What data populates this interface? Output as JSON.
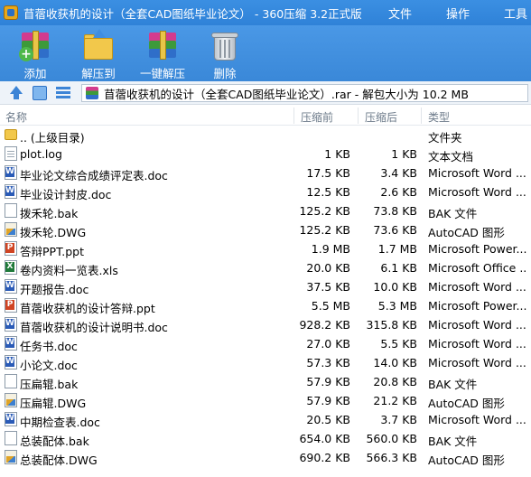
{
  "window": {
    "title": "苜蓿收获机的设计（全套CAD图纸毕业论文） - 360压缩 3.2正式版",
    "menus": [
      "文件",
      "操作",
      "工具"
    ]
  },
  "toolbar": {
    "buttons": [
      {
        "label": "添加",
        "icon": "add-archive-icon"
      },
      {
        "label": "解压到",
        "icon": "extract-to-folder-icon"
      },
      {
        "label": "一键解压",
        "icon": "one-click-extract-icon"
      },
      {
        "label": "删除",
        "icon": "trash-icon"
      }
    ]
  },
  "address": {
    "path": "苜蓿收获机的设计（全套CAD图纸毕业论文）.rar - 解包大小为 10.2 MB"
  },
  "columns": {
    "name": "名称",
    "size": "压缩前",
    "packed": "压缩后",
    "type": "类型"
  },
  "files": [
    {
      "name": ".. (上级目录)",
      "size": "",
      "packed": "",
      "type": "文件夹",
      "icon": "folder"
    },
    {
      "name": "plot.log",
      "size": "1 KB",
      "packed": "1 KB",
      "type": "文本文档",
      "icon": "txt"
    },
    {
      "name": "毕业论文综合成绩评定表.doc",
      "size": "17.5 KB",
      "packed": "3.4 KB",
      "type": "Microsoft Word ...",
      "icon": "doc"
    },
    {
      "name": "毕业设计封皮.doc",
      "size": "12.5 KB",
      "packed": "2.6 KB",
      "type": "Microsoft Word ...",
      "icon": "doc"
    },
    {
      "name": "拨禾轮.bak",
      "size": "125.2 KB",
      "packed": "73.8 KB",
      "type": "BAK 文件",
      "icon": "bak"
    },
    {
      "name": "拨禾轮.DWG",
      "size": "125.2 KB",
      "packed": "73.6 KB",
      "type": "AutoCAD 图形",
      "icon": "dwg"
    },
    {
      "name": "答辩PPT.ppt",
      "size": "1.9 MB",
      "packed": "1.7 MB",
      "type": "Microsoft Power...",
      "icon": "ppt"
    },
    {
      "name": "卷内资料一览表.xls",
      "size": "20.0 KB",
      "packed": "6.1 KB",
      "type": "Microsoft Office ...",
      "icon": "xls"
    },
    {
      "name": "开题报告.doc",
      "size": "37.5 KB",
      "packed": "10.0 KB",
      "type": "Microsoft Word ...",
      "icon": "doc"
    },
    {
      "name": "苜蓿收获机的设计答辩.ppt",
      "size": "5.5 MB",
      "packed": "5.3 MB",
      "type": "Microsoft Power...",
      "icon": "ppt"
    },
    {
      "name": "苜蓿收获机的设计说明书.doc",
      "size": "928.2 KB",
      "packed": "315.8 KB",
      "type": "Microsoft Word ...",
      "icon": "doc"
    },
    {
      "name": "任务书.doc",
      "size": "27.0 KB",
      "packed": "5.5 KB",
      "type": "Microsoft Word ...",
      "icon": "doc"
    },
    {
      "name": "小论文.doc",
      "size": "57.3 KB",
      "packed": "14.0 KB",
      "type": "Microsoft Word ...",
      "icon": "doc"
    },
    {
      "name": "压扁辊.bak",
      "size": "57.9 KB",
      "packed": "20.8 KB",
      "type": "BAK 文件",
      "icon": "bak"
    },
    {
      "name": "压扁辊.DWG",
      "size": "57.9 KB",
      "packed": "21.2 KB",
      "type": "AutoCAD 图形",
      "icon": "dwg"
    },
    {
      "name": "中期检查表.doc",
      "size": "20.5 KB",
      "packed": "3.7 KB",
      "type": "Microsoft Word ...",
      "icon": "doc"
    },
    {
      "name": "总装配体.bak",
      "size": "654.0 KB",
      "packed": "560.0 KB",
      "type": "BAK 文件",
      "icon": "bak"
    },
    {
      "name": "总装配体.DWG",
      "size": "690.2 KB",
      "packed": "566.3 KB",
      "type": "AutoCAD 图形",
      "icon": "dwg"
    }
  ]
}
